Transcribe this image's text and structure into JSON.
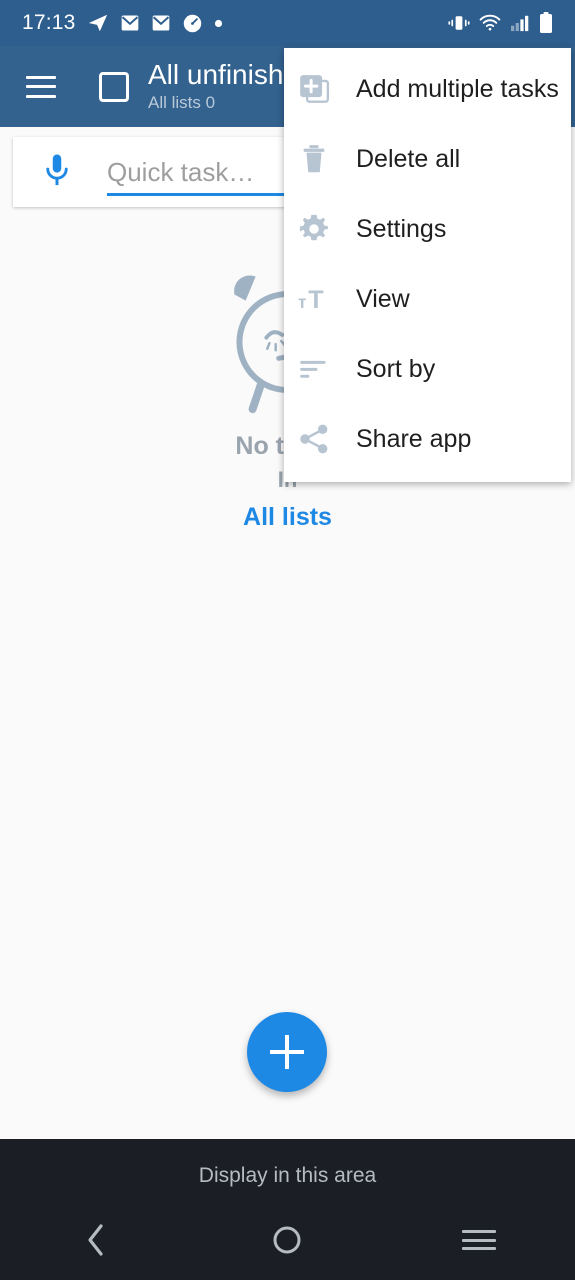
{
  "status_bar": {
    "time": "17:13",
    "left_icons": [
      "telegram-icon",
      "mail-icon",
      "mail-icon",
      "clock-speed-icon",
      "dot-icon"
    ],
    "right_icons": [
      "vibrate-icon",
      "wifi-icon",
      "signal-icon",
      "battery-icon"
    ]
  },
  "app_bar": {
    "menu_icon": "hamburger-menu-icon",
    "checkbox_icon": "unchecked-checkbox-icon",
    "title": "All unfinished",
    "subtitle": "All lists 0"
  },
  "quick_task": {
    "mic_icon": "microphone-icon",
    "placeholder": "Quick task…",
    "value": ""
  },
  "empty_state": {
    "illustration": "sleeping-alarm-clock-icon",
    "line1": "No tasks",
    "line2": "In",
    "link": "All lists"
  },
  "fab": {
    "icon": "plus-icon",
    "label": "+"
  },
  "overflow_menu": {
    "items": [
      {
        "label": "Add multiple tasks",
        "icon": "library-add-icon"
      },
      {
        "label": "Delete all",
        "icon": "trash-icon"
      },
      {
        "label": "Settings",
        "icon": "gear-icon"
      },
      {
        "label": "View",
        "icon": "format-size-icon"
      },
      {
        "label": "Sort by",
        "icon": "sort-icon"
      },
      {
        "label": "Share app",
        "icon": "share-icon"
      }
    ]
  },
  "bottom": {
    "display_text": "Display in this area",
    "nav": {
      "back": "back-chevron-icon",
      "home": "home-circle-icon",
      "recents": "recents-icon"
    }
  },
  "colors": {
    "status_bar": "#2e5e8e",
    "app_bar": "#33628f",
    "accent": "#1e88e5",
    "page_bg": "#fafafa",
    "menu_bg": "#ffffff",
    "bottom_bg": "#1b1e24",
    "muted_text": "#9aa4ae"
  }
}
